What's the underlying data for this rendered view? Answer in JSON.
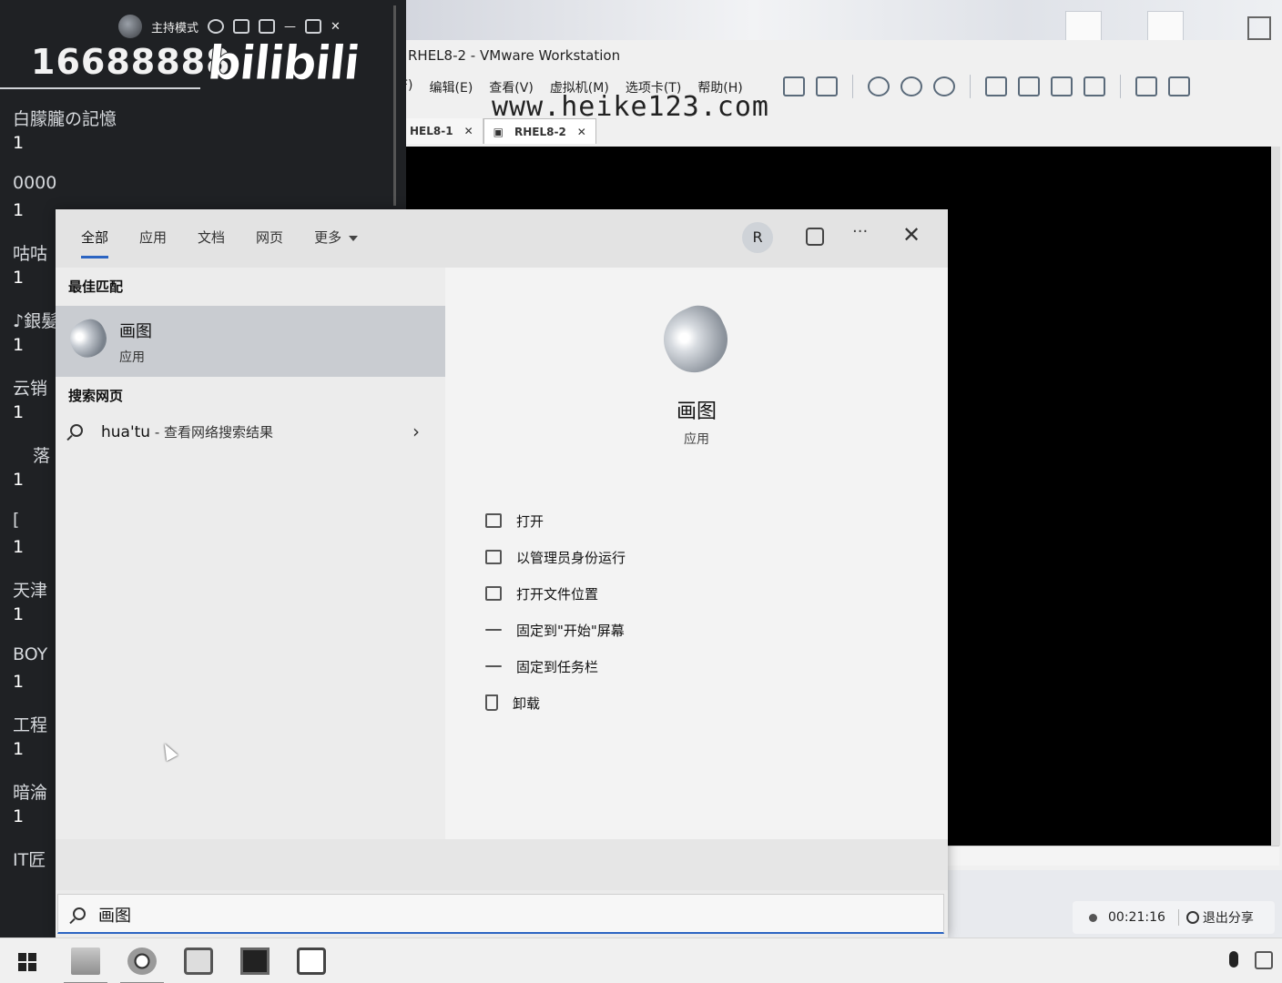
{
  "live_panel": {
    "mode_label": "主持模式",
    "room_number": "16688888",
    "logo": "bilibili",
    "viewers": [
      {
        "name": "白朦朧の記憶",
        "value": "1"
      },
      {
        "name": "0000",
        "value": "1"
      },
      {
        "name": "咕咕",
        "value": "1"
      },
      {
        "name": "♪銀髪",
        "value": "1"
      },
      {
        "name": "云销",
        "value": "1"
      },
      {
        "name": "落",
        "value": "1"
      },
      {
        "name": "[",
        "value": "1"
      },
      {
        "name": "天津",
        "value": "1"
      },
      {
        "name": "BOY",
        "value": "1"
      },
      {
        "name": "工程",
        "value": "1"
      },
      {
        "name": "暗淪",
        "value": "1"
      },
      {
        "name": "IT匠",
        "value": ""
      }
    ]
  },
  "vmware": {
    "title": "RHEL8-2 - VMware Workstation",
    "menu": [
      "F)",
      "编辑(E)",
      "查看(V)",
      "虚拟机(M)",
      "选项卡(T)",
      "帮助(H)"
    ],
    "tabs": [
      {
        "label": "HEL8-1",
        "active": false
      },
      {
        "label": "RHEL8-2",
        "active": true
      }
    ]
  },
  "watermark": "www.heike123.com",
  "search": {
    "tabs": [
      {
        "label": "全部",
        "active": true
      },
      {
        "label": "应用",
        "active": false
      },
      {
        "label": "文档",
        "active": false
      },
      {
        "label": "网页",
        "active": false
      },
      {
        "label": "更多",
        "active": false,
        "dropdown": true
      }
    ],
    "account_initial": "R",
    "more_label": "···",
    "close_label": "✕",
    "best_match_heading": "最佳匹配",
    "best_match": {
      "name": "画图",
      "type": "应用"
    },
    "web_heading": "搜索网页",
    "web_result": {
      "query": "hua'tu",
      "suffix": " - 查看网络搜索结果"
    },
    "detail": {
      "name": "画图",
      "type": "应用"
    },
    "actions": [
      {
        "label": "打开",
        "icon": "open-icon"
      },
      {
        "label": "以管理员身份运行",
        "icon": "admin-shield-icon"
      },
      {
        "label": "打开文件位置",
        "icon": "file-location-icon"
      },
      {
        "label": "固定到\"开始\"屏幕",
        "icon": "pin-icon"
      },
      {
        "label": "固定到任务栏",
        "icon": "pin-icon"
      },
      {
        "label": "卸载",
        "icon": "trash-icon"
      }
    ],
    "input_value": "画图"
  },
  "share": {
    "elapsed": "00:21:16",
    "exit_label": "退出分享"
  }
}
